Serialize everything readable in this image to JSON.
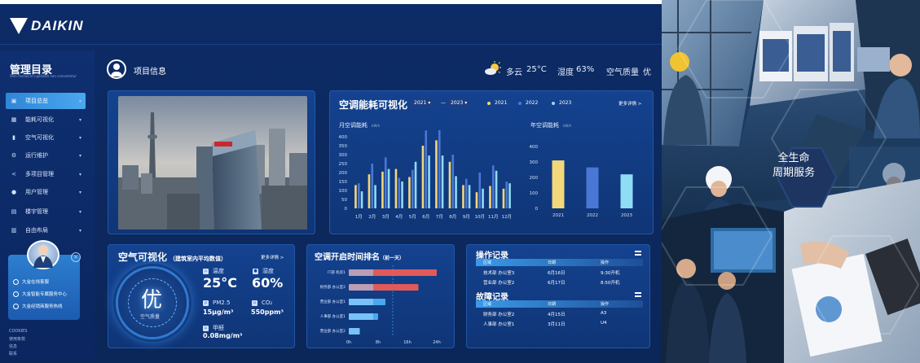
{
  "brand": "DAIKIN",
  "sidebar": {
    "title": "管理目录",
    "subtitle": "Shiti mosaical cupidatat non consectetur",
    "items": [
      {
        "label": "项目总览",
        "icon": "project-icon",
        "active": true
      },
      {
        "label": "能耗可视化",
        "icon": "grid-icon"
      },
      {
        "label": "空气可视化",
        "icon": "bar-chart-icon"
      },
      {
        "label": "运行维护",
        "icon": "gear-icon"
      },
      {
        "label": "多项目管理",
        "icon": "share-icon"
      },
      {
        "label": "用户管理",
        "icon": "info-icon"
      },
      {
        "label": "楼宇管理",
        "icon": "building-icon"
      },
      {
        "label": "自由布局",
        "icon": "layout-icon"
      }
    ],
    "service": [
      "大金在线客服",
      "大金智能专属服务中心",
      "大金经销商服务热线"
    ],
    "footer": [
      "COOKIES",
      "使用条款",
      "信息",
      "联系"
    ]
  },
  "header": {
    "title": "项目信息",
    "weather": "多云",
    "temperature": "25°C",
    "humidity_label": "湿度",
    "humidity": "63%",
    "air_label": "空气质量",
    "air": "优"
  },
  "energy": {
    "title": "空调能耗可视化",
    "year_from": "2021",
    "dash": "—",
    "year_to": "2023",
    "more": "更多详情 >",
    "legend": [
      "2021",
      "2022",
      "2023"
    ],
    "colors": [
      "#f2d87a",
      "#4a77d4",
      "#8fdcf5"
    ],
    "monthly_title": "月空调能耗",
    "annual_title": "年空调能耗",
    "unit": "kW/h"
  },
  "air": {
    "title": "空气可视化",
    "subtitle": "（建筑室内平均数值）",
    "more": "更多详情 >",
    "grade": "优",
    "grade_caption": "空气质量",
    "metrics": [
      {
        "label": "温度",
        "value": "25°C"
      },
      {
        "label": "湿度",
        "value": "60%"
      },
      {
        "label": "PM2.5",
        "value": "15μg/m³"
      },
      {
        "label": "CO₂",
        "value": "550ppm³"
      },
      {
        "label": "甲醛",
        "value": "0.08mg/m³"
      }
    ]
  },
  "ranking": {
    "title": "空调开启时间排名",
    "subtitle": "（前一天）"
  },
  "operations": {
    "title": "操作记录",
    "headers": [
      "区域",
      "日期",
      "操作"
    ],
    "rows": [
      [
        "技术部 办公室3",
        "6月16日",
        "9:30开机"
      ],
      [
        "营业部 办公室2",
        "6月17日",
        "8:50开机"
      ]
    ]
  },
  "faults": {
    "title": "故障记录",
    "headers": [
      "区域",
      "日期",
      "操作"
    ],
    "rows": [
      [
        "财务部 办公室2",
        "4月15日",
        "A3"
      ],
      [
        "人事部 办公室1",
        "3月11日",
        "U4"
      ]
    ]
  },
  "promo": {
    "caption_line1": "全生命",
    "caption_line2": "周期服务"
  },
  "chart_data": [
    {
      "type": "bar",
      "title": "月空调能耗",
      "ylabel": "kW/h",
      "categories": [
        "1月",
        "2月",
        "3月",
        "4月",
        "5月",
        "6月",
        "7月",
        "8月",
        "9月",
        "10月",
        "11月",
        "12月"
      ],
      "series": [
        {
          "name": "2021",
          "values": [
            130,
            190,
            205,
            220,
            175,
            350,
            380,
            260,
            130,
            90,
            125,
            110
          ]
        },
        {
          "name": "2022",
          "values": [
            140,
            250,
            285,
            170,
            215,
            435,
            450,
            300,
            165,
            200,
            240,
            150
          ]
        },
        {
          "name": "2023",
          "values": [
            95,
            130,
            220,
            150,
            260,
            295,
            295,
            180,
            130,
            110,
            210,
            140
          ]
        }
      ],
      "yticks": [
        0,
        50,
        100,
        150,
        200,
        250,
        300,
        350,
        400
      ],
      "ylim": [
        0,
        400
      ]
    },
    {
      "type": "bar",
      "title": "年空调能耗",
      "ylabel": "kW/h",
      "categories": [
        "2021",
        "2022",
        "2023"
      ],
      "values": [
        310,
        265,
        220
      ],
      "yticks": [
        0,
        100,
        200,
        300,
        400
      ],
      "ylim": [
        0,
        400
      ]
    },
    {
      "type": "bar",
      "orientation": "horizontal",
      "title": "空调开启时间排名",
      "categories": [
        "IT部 机房1",
        "财务部 办公室2",
        "营业部 办公室1",
        "人事部 办公室1",
        "营业部 办公室2"
      ],
      "values": [
        24,
        19,
        10,
        8,
        3
      ],
      "xticks": [
        "0h",
        "8h",
        "16h",
        "24h"
      ],
      "xlim": [
        0,
        24
      ]
    }
  ]
}
